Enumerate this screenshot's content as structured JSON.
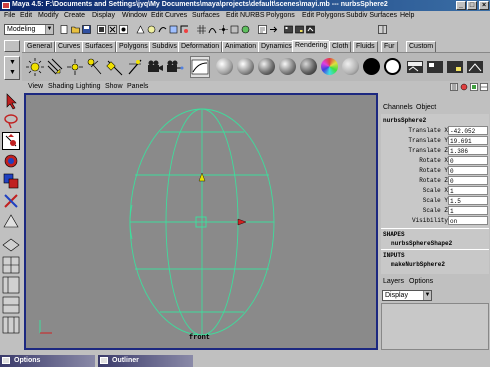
{
  "window": {
    "title": "Maya 4.5: F:\\Documents and Settings\\jyq\\My Documents\\maya\\projects\\default\\scenes\\mayi.mb   ---   nurbsSphere2",
    "buttons": [
      "_",
      "□",
      "×"
    ]
  },
  "menubar": [
    "File",
    "Edit",
    "Modify",
    "Create",
    "Display",
    "Window",
    "Edit Curves",
    "Surfaces",
    "Edit NURBS",
    "Polygons",
    "Edit Polygons",
    "Subdiv Surfaces",
    "Help"
  ],
  "statusline": {
    "mode": "Modeling"
  },
  "shelf": {
    "tabs": [
      "General",
      "Curves",
      "Surfaces",
      "Polygons",
      "Subdivs",
      "Deformation",
      "Animation",
      "Dynamics",
      "Rendering",
      "Cloth",
      "Fluids",
      "Fur",
      "Custom"
    ],
    "active_tab": "Rendering"
  },
  "panel": {
    "menu": [
      "View",
      "Shading",
      "Lighting",
      "Show",
      "Panels"
    ],
    "camera_label": "front"
  },
  "channel_box": {
    "menu": [
      "Channels",
      "Object"
    ],
    "object_name": "nurbsSphere2",
    "attributes": [
      {
        "label": "Translate X",
        "value": "-42.052"
      },
      {
        "label": "Translate Y",
        "value": "19.691"
      },
      {
        "label": "Translate Z",
        "value": "1.386"
      },
      {
        "label": "Rotate X",
        "value": "0"
      },
      {
        "label": "Rotate Y",
        "value": "0"
      },
      {
        "label": "Rotate Z",
        "value": "0"
      },
      {
        "label": "Scale X",
        "value": "1"
      },
      {
        "label": "Scale Y",
        "value": "1.5"
      },
      {
        "label": "Scale Z",
        "value": "1"
      },
      {
        "label": "Visibility",
        "value": "on"
      }
    ],
    "shapes_header": "SHAPES",
    "shape_name": "nurbsSphereShape2",
    "inputs_header": "INPUTS",
    "input_name": "makeNurbSphere2"
  },
  "layers": {
    "menu": [
      "Layers",
      "Options"
    ],
    "display_value": "Display"
  },
  "bottom_panels": [
    {
      "label": "Options"
    },
    {
      "label": "Outliner"
    }
  ],
  "colors": {
    "wireframe": "#3fdc9c",
    "viewport_bg": "#8a8a8a",
    "viewport_border": "#1c2880"
  }
}
